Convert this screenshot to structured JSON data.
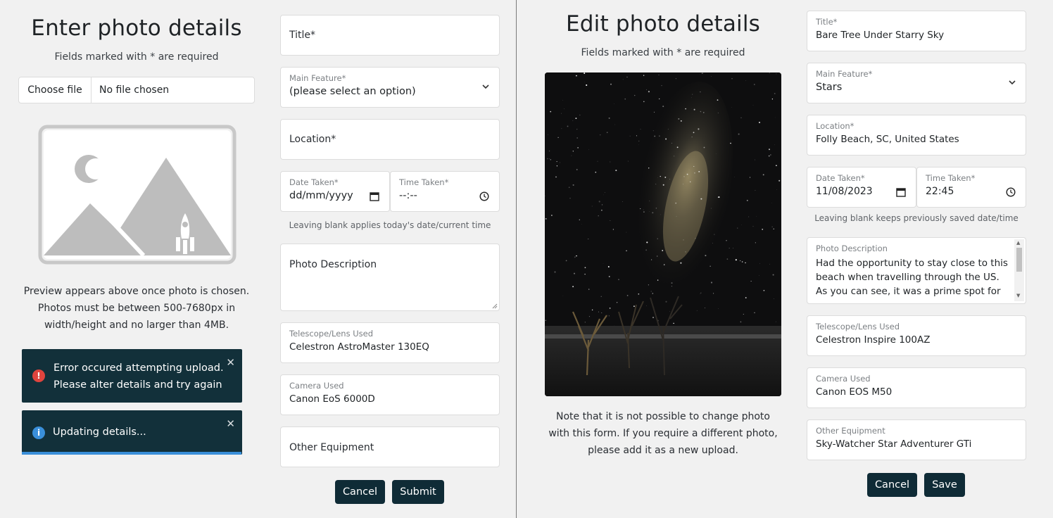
{
  "left": {
    "title": "Enter photo details",
    "required_note": "Fields marked with * are required",
    "file": {
      "button": "Choose file",
      "status": "No file chosen"
    },
    "preview_note": "Preview appears above once photo is chosen. Photos must be between 500-7680px in width/height and no larger than 4MB.",
    "toasts": [
      {
        "type": "error",
        "line1": "Error occured attempting upload.",
        "line2": "Please alter details and try again",
        "close": "✕"
      },
      {
        "type": "info",
        "text": "Updating details...",
        "close": "✕"
      }
    ],
    "form": {
      "title_placeholder": "Title*",
      "main_feature_label": "Main Feature*",
      "main_feature_value": "(please select an option)",
      "location_placeholder": "Location*",
      "date_label": "Date Taken*",
      "date_value": "dd/mm/yyyy",
      "time_label": "Time Taken*",
      "time_value": "--:--",
      "datetime_help": "Leaving blank applies today's date/current time",
      "description_placeholder": "Photo Description",
      "telescope_label": "Telescope/Lens Used",
      "telescope_value": "Celestron AstroMaster 130EQ",
      "camera_label": "Camera Used",
      "camera_value": "Canon EoS 6000D",
      "other_placeholder": "Other Equipment",
      "cancel": "Cancel",
      "submit": "Submit"
    }
  },
  "right": {
    "title": "Edit photo details",
    "required_note": "Fields marked with * are required",
    "photo_note": "Note that it is not possible to change photo with this form. If you require a different photo, please add it as a new upload.",
    "form": {
      "title_label": "Title*",
      "title_value": "Bare Tree Under Starry Sky",
      "main_feature_label": "Main Feature*",
      "main_feature_value": "Stars",
      "location_label": "Location*",
      "location_value": "Folly Beach, SC, United States",
      "date_label": "Date Taken*",
      "date_value": "11/08/2023",
      "time_label": "Time Taken*",
      "time_value": "22:45",
      "datetime_help": "Leaving blank keeps previously saved date/time",
      "description_label": "Photo Description",
      "description_value": "Had the opportunity to stay close to this beach when travelling through the US. As you can see, it was a prime spot for astrophotography",
      "telescope_label": "Telescope/Lens Used",
      "telescope_value": "Celestron Inspire 100AZ",
      "camera_label": "Camera Used",
      "camera_value": "Canon EOS M50",
      "other_label": "Other Equipment",
      "other_value": "Sky-Watcher Star Adventurer GTi",
      "cancel": "Cancel",
      "save": "Save"
    }
  },
  "colors": {
    "button": "#0f2b36",
    "toast": "#12303a",
    "error_icon": "#e0443e",
    "info_icon": "#3a8fd9",
    "progress": "#3a8fd9"
  }
}
